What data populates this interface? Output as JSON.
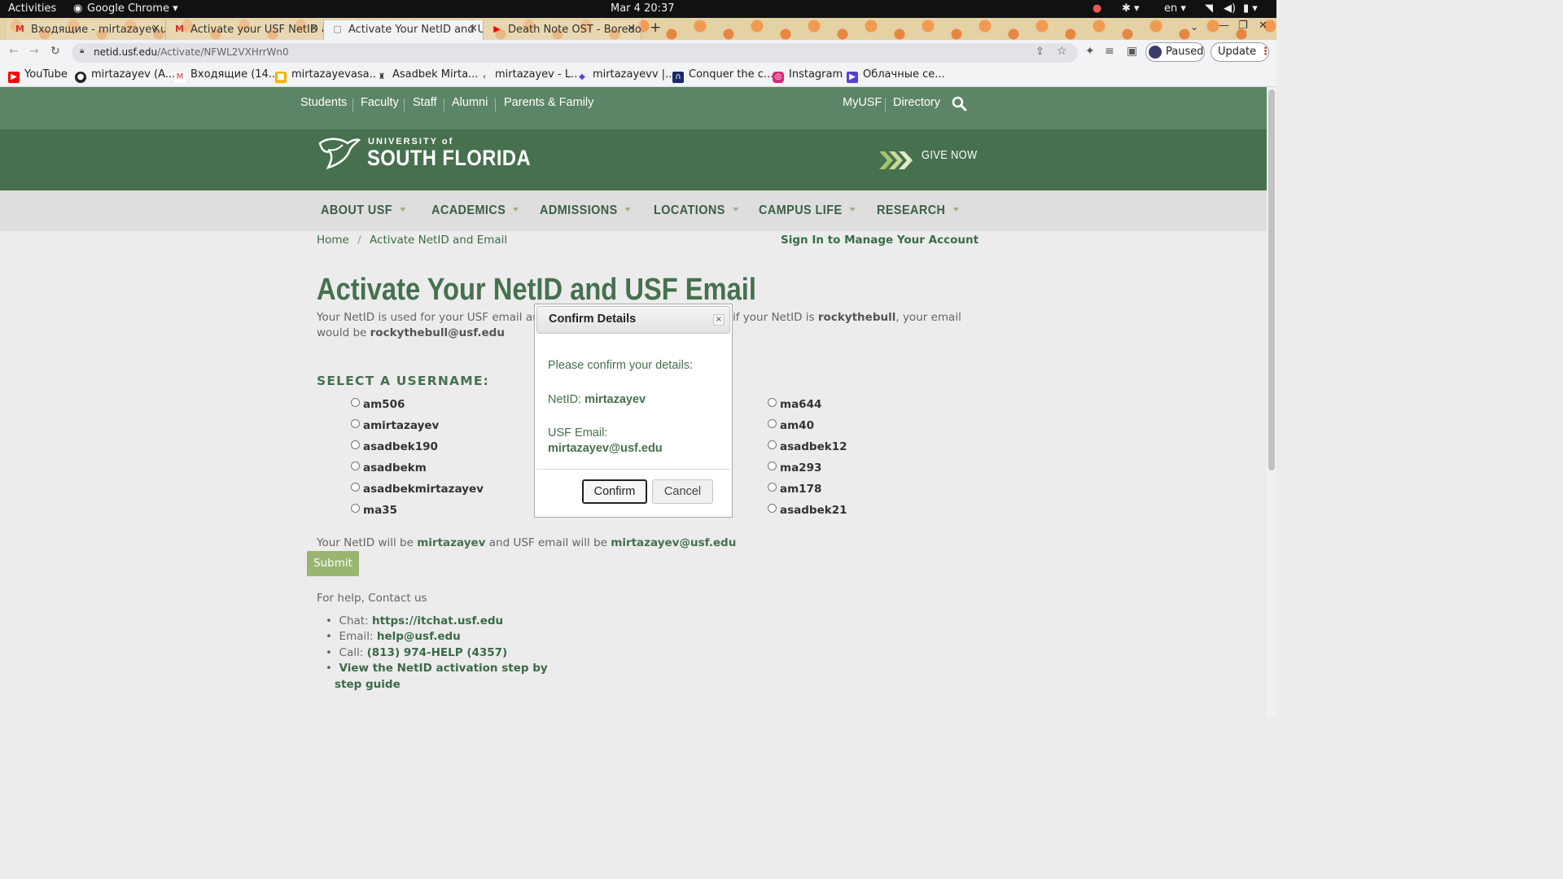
{
  "topbar": {
    "activities": "Activities",
    "app": "Google Chrome",
    "clock": "Mar 4  20:37",
    "lang": "en"
  },
  "tabs": [
    {
      "title": "Входящие - mirtazayev.u",
      "icon": "gmail-icon"
    },
    {
      "title": "Activate your USF NetID a",
      "icon": "gmail-icon"
    },
    {
      "title": "Activate Your NetID and U",
      "icon": "page-icon"
    },
    {
      "title": "Death Note OST - Boredo",
      "icon": "youtube-icon"
    }
  ],
  "toolbar": {
    "url_host": "netid.usf.edu",
    "url_path": "/Activate/NFWL2VXHrrWn0",
    "paused": "Paused",
    "update": "Update"
  },
  "bookmarks": [
    "YouTube",
    "mirtazayev (A...",
    "Входящие (14...",
    "mirtazayevasa...",
    "Asadbek Mirta...",
    "mirtazayev - L...",
    "mirtazayevv |...",
    "Conquer the c...",
    "Instagram",
    "Облачные се..."
  ],
  "site": {
    "util_left": [
      "Students",
      "Faculty",
      "Staff",
      "Alumni",
      "Parents & Family"
    ],
    "util_right": [
      "MyUSF",
      "Directory"
    ],
    "brand_top": "UNIVERSITY of",
    "brand_main": "SOUTH FLORIDA",
    "give_now": "GIVE NOW",
    "nav": [
      "ABOUT USF",
      "ACADEMICS",
      "ADMISSIONS",
      "LOCATIONS",
      "CAMPUS LIFE",
      "RESEARCH"
    ],
    "breadcrumb_home": "Home",
    "breadcrumb_current": "Activate NetID and Email",
    "sign_in": "Sign In to Manage Your Account",
    "page_title": "Activate Your NetID and USF Email",
    "intro_a": "Your NetID is used for your USF email and lo",
    "intro_b": "if your NetID is",
    "intro_example": "rockythebull",
    "intro_c": ", your email",
    "intro_d": "would be",
    "intro_email": "rockythebull@usf.edu",
    "select_heading": "SELECT A USERNAME:",
    "options_left": [
      "am506",
      "amirtazayev",
      "asadbek190",
      "asadbekm",
      "asadbekmirtazayev",
      "ma35"
    ],
    "options_right": [
      "ma644",
      "am40",
      "asadbek12",
      "ma293",
      "am178",
      "asadbek21"
    ],
    "summary_a": "Your NetID will be",
    "summary_netid": "mirtazayev",
    "summary_b": "and USF email will be",
    "summary_email": "mirtazayev@usf.edu",
    "submit": "Submit",
    "help_heading": "For help, Contact us",
    "help": {
      "chat_label": "Chat:",
      "chat_value": "https://itchat.usf.edu",
      "email_label": "Email:",
      "email_value": "help@usf.edu",
      "call_label": "Call:",
      "call_value": "(813) 974-HELP (4357)",
      "guide_1": "View the NetID activation step by",
      "guide_2": "step guide"
    }
  },
  "modal": {
    "title": "Confirm Details",
    "close": "×",
    "prompt": "Please confirm your details:",
    "netid_label": "NetID:",
    "netid_value": "mirtazayev",
    "email_label": "USF Email:",
    "email_value": "mirtazayev@usf.edu",
    "confirm": "Confirm",
    "cancel": "Cancel"
  },
  "colors": {
    "green_dark": "#47704f",
    "green_util": "#5c8567",
    "submit": "#9ab570"
  }
}
